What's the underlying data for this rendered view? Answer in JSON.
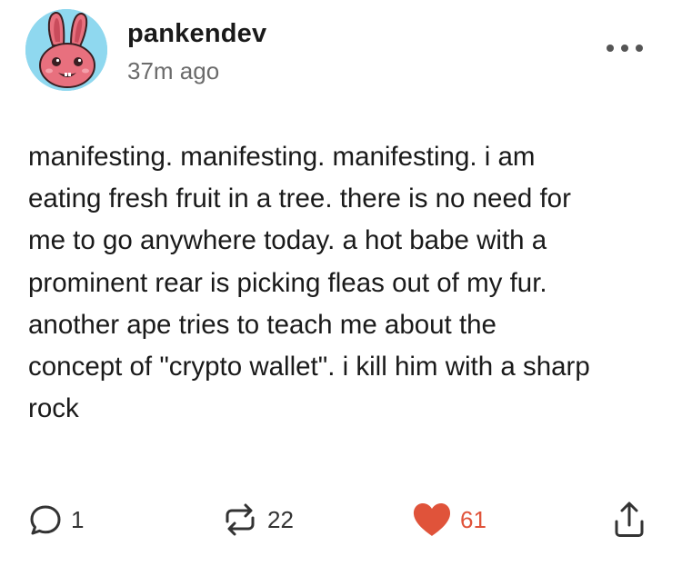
{
  "post": {
    "username": "pankendev",
    "timestamp": "37m ago",
    "body_lines": [
      "manifesting. manifesting. manifesting. i am",
      "eating fresh fruit in a tree. there is no need for",
      "me to go anywhere today. a hot babe with a",
      "prominent rear is picking fleas out of my fur.",
      "another ape tries to teach me about the",
      "concept of \"crypto wallet\". i kill him with a sharp",
      "rock"
    ]
  },
  "actions": {
    "replies": "1",
    "reblogs": "22",
    "likes": "61"
  },
  "icons": {
    "avatar": "pink-bunny-avatar",
    "more": "more-horizontal-icon",
    "reply": "speech-bubble-icon",
    "reblog": "reblog-arrows-icon",
    "like": "heart-icon",
    "share": "share-upload-icon"
  },
  "colors": {
    "like": "#e0533a",
    "avatar_bg": "#8fd8ef",
    "avatar_bunny": "#e8707e"
  }
}
